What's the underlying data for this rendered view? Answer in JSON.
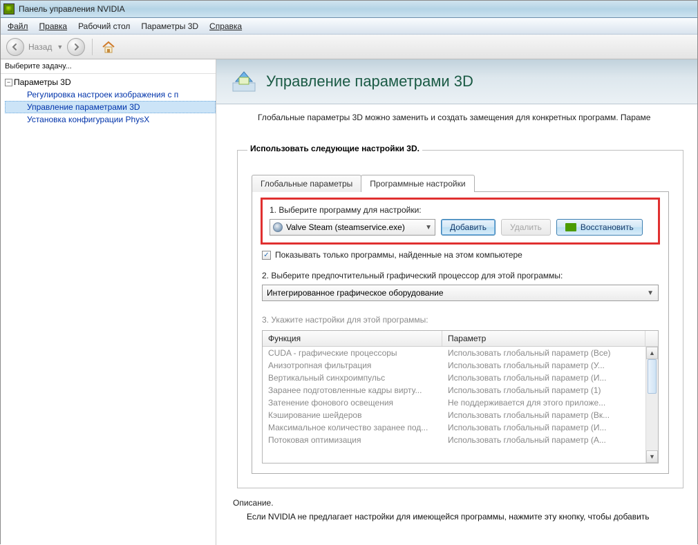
{
  "titlebar": {
    "text": "Панель управления NVIDIA"
  },
  "menubar": {
    "file": "Файл",
    "edit": "Правка",
    "desktop": "Рабочий стол",
    "params3d": "Параметры 3D",
    "help": "Справка"
  },
  "navbar": {
    "back": "Назад"
  },
  "sidebar": {
    "heading": "Выберите задачу...",
    "root": "Параметры 3D",
    "children": [
      "Регулировка настроек изображения с п",
      "Управление параметрами 3D",
      "Установка конфигурации PhysX"
    ]
  },
  "header": {
    "title": "Управление параметрами 3D",
    "subtitle": "Глобальные параметры 3D можно заменить и создать замещения для конкретных программ. Параме"
  },
  "card": {
    "legend": "Использовать следующие настройки 3D.",
    "tabs": {
      "global": "Глобальные параметры",
      "program": "Программные настройки"
    },
    "step1_label": "1. Выберите программу для настройки:",
    "program_dropdown": "Valve Steam (steamservice.exe)",
    "add_btn": "Добавить",
    "remove_btn": "Удалить",
    "restore_btn": "Восстановить",
    "checkbox_label": "Показывать только программы, найденные на этом компьютере",
    "step2_label": "2. Выберите предпочтительный графический процессор для этой программы:",
    "gpu_dropdown": "Интегрированное графическое оборудование",
    "step3_label": "3. Укажите настройки для этой программы:",
    "grid_headers": {
      "c1": "Функция",
      "c2": "Параметр"
    },
    "rows": [
      {
        "f": "CUDA - графические процессоры",
        "p": "Использовать глобальный параметр (Все)"
      },
      {
        "f": "Анизотропная фильтрация",
        "p": "Использовать глобальный параметр (У..."
      },
      {
        "f": "Вертикальный синхроимпульс",
        "p": "Использовать глобальный параметр (И..."
      },
      {
        "f": "Заранее подготовленные кадры вирту...",
        "p": "Использовать глобальный параметр (1)"
      },
      {
        "f": "Затенение фонового освещения",
        "p": "Не поддерживается для этого приложе..."
      },
      {
        "f": "Кэширование шейдеров",
        "p": "Использовать глобальный параметр (Вк..."
      },
      {
        "f": "Максимальное количество заранее под...",
        "p": "Использовать глобальный параметр (И..."
      },
      {
        "f": "Потоковая оптимизация",
        "p": "Использовать глобальный параметр (А..."
      }
    ]
  },
  "description": {
    "head": "Описание.",
    "body": "Если NVIDIA не предлагает настройки для имеющейся программы, нажмите эту кнопку, чтобы добавить"
  }
}
